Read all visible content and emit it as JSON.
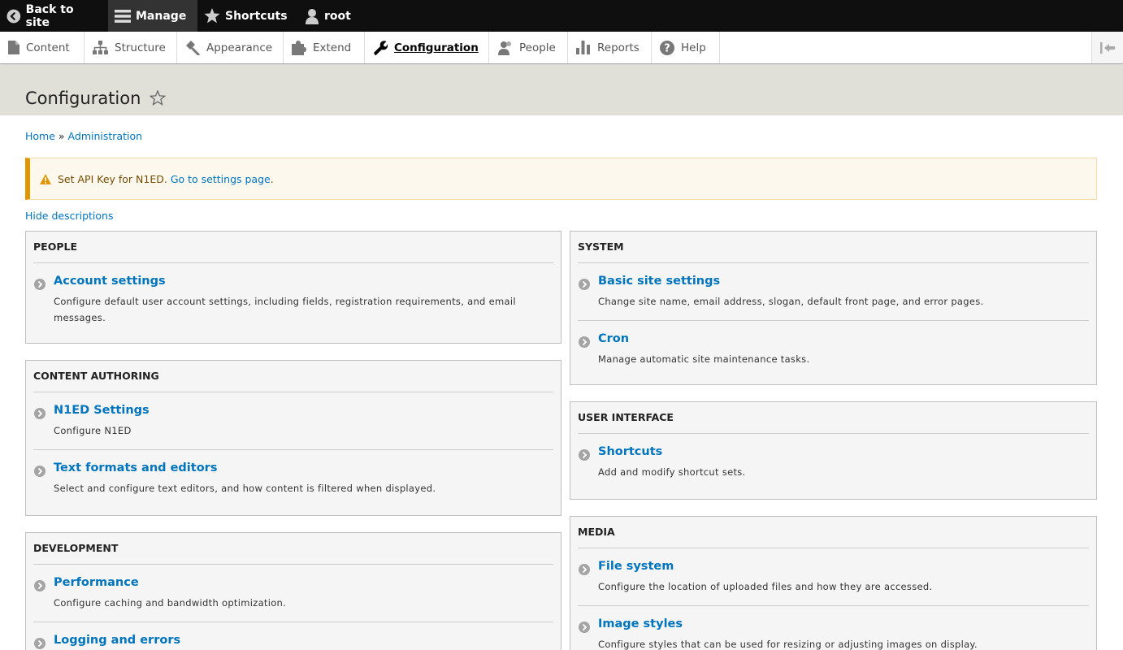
{
  "toolbar": {
    "back": "Back to site",
    "manage": "Manage",
    "shortcuts": "Shortcuts",
    "user": "root"
  },
  "tray": {
    "items": [
      "Content",
      "Structure",
      "Appearance",
      "Extend",
      "Configuration",
      "People",
      "Reports",
      "Help"
    ]
  },
  "page": {
    "title": "Configuration"
  },
  "breadcrumb": {
    "home": "Home",
    "sep": "»",
    "admin": "Administration"
  },
  "message": {
    "text": "Set API Key for N1ED.",
    "link": "Go to settings page",
    "suffix": "."
  },
  "hide_descriptions": "Hide descriptions",
  "panels": {
    "people": {
      "title": "PEOPLE",
      "items": [
        {
          "label": "Account settings",
          "desc": "Configure default user account settings, including fields, registration requirements, and email messages."
        }
      ]
    },
    "content_authoring": {
      "title": "CONTENT AUTHORING",
      "items": [
        {
          "label": "N1ED Settings",
          "desc": "Configure N1ED"
        },
        {
          "label": "Text formats and editors",
          "desc": "Select and configure text editors, and how content is filtered when displayed."
        }
      ]
    },
    "development": {
      "title": "DEVELOPMENT",
      "items": [
        {
          "label": "Performance",
          "desc": "Configure caching and bandwidth optimization."
        },
        {
          "label": "Logging and errors",
          "desc": ""
        }
      ]
    },
    "system": {
      "title": "SYSTEM",
      "items": [
        {
          "label": "Basic site settings",
          "desc": "Change site name, email address, slogan, default front page, and error pages."
        },
        {
          "label": "Cron",
          "desc": "Manage automatic site maintenance tasks."
        }
      ]
    },
    "user_interface": {
      "title": "USER INTERFACE",
      "items": [
        {
          "label": "Shortcuts",
          "desc": "Add and modify shortcut sets."
        }
      ]
    },
    "media": {
      "title": "MEDIA",
      "items": [
        {
          "label": "File system",
          "desc": "Configure the location of uploaded files and how they are accessed."
        },
        {
          "label": "Image styles",
          "desc": "Configure styles that can be used for resizing or adjusting images on display."
        }
      ]
    }
  }
}
